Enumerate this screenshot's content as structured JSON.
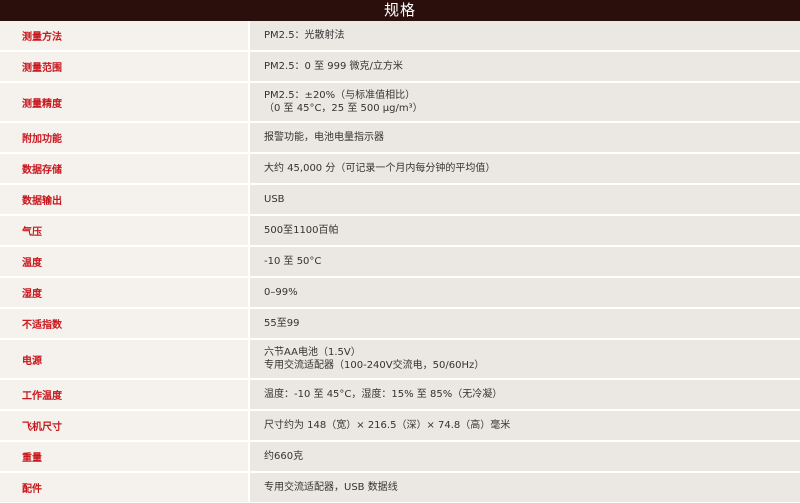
{
  "header": {
    "title": "规格"
  },
  "rows": [
    {
      "label": "测量方法",
      "lines": [
        "PM2.5：光散射法"
      ]
    },
    {
      "label": "测量范围",
      "lines": [
        "PM2.5：0 至 999 微克/立方米"
      ]
    },
    {
      "label": "测量精度",
      "lines": [
        "PM2.5：±20%（与标准值相比）",
        "（0 至 45°C，25 至 500 μg/m³）"
      ]
    },
    {
      "label": "附加功能",
      "lines": [
        "报警功能，电池电量指示器"
      ]
    },
    {
      "label": "数据存储",
      "lines": [
        "大约 45,000 分（可记录一个月内每分钟的平均值）"
      ]
    },
    {
      "label": "数据输出",
      "lines": [
        "USB"
      ]
    },
    {
      "label": "气压",
      "lines": [
        "500至1100百帕"
      ]
    },
    {
      "label": "温度",
      "lines": [
        "-10 至 50°C"
      ]
    },
    {
      "label": "湿度",
      "lines": [
        "0–99%"
      ]
    },
    {
      "label": "不适指数",
      "lines": [
        "55至99"
      ]
    },
    {
      "label": "电源",
      "lines": [
        "六节AA电池（1.5V）",
        "专用交流适配器（100-240V交流电，50/60Hz）"
      ]
    },
    {
      "label": "工作温度",
      "lines": [
        "温度：-10 至 45°C，湿度：15% 至 85%（无冷凝）"
      ]
    },
    {
      "label": "飞机尺寸",
      "lines": [
        "尺寸约为 148（宽）× 216.5（深）× 74.8（高）毫米"
      ]
    },
    {
      "label": "重量",
      "lines": [
        "约660克"
      ]
    },
    {
      "label": "配件",
      "lines": [
        "专用交流适配器，USB 数据线"
      ]
    }
  ],
  "colors": {
    "header_bg": "#2a0f0c",
    "label_text": "#c8161d",
    "label_bg": "#f5f2ee",
    "value_bg": "#ebe8e3"
  }
}
